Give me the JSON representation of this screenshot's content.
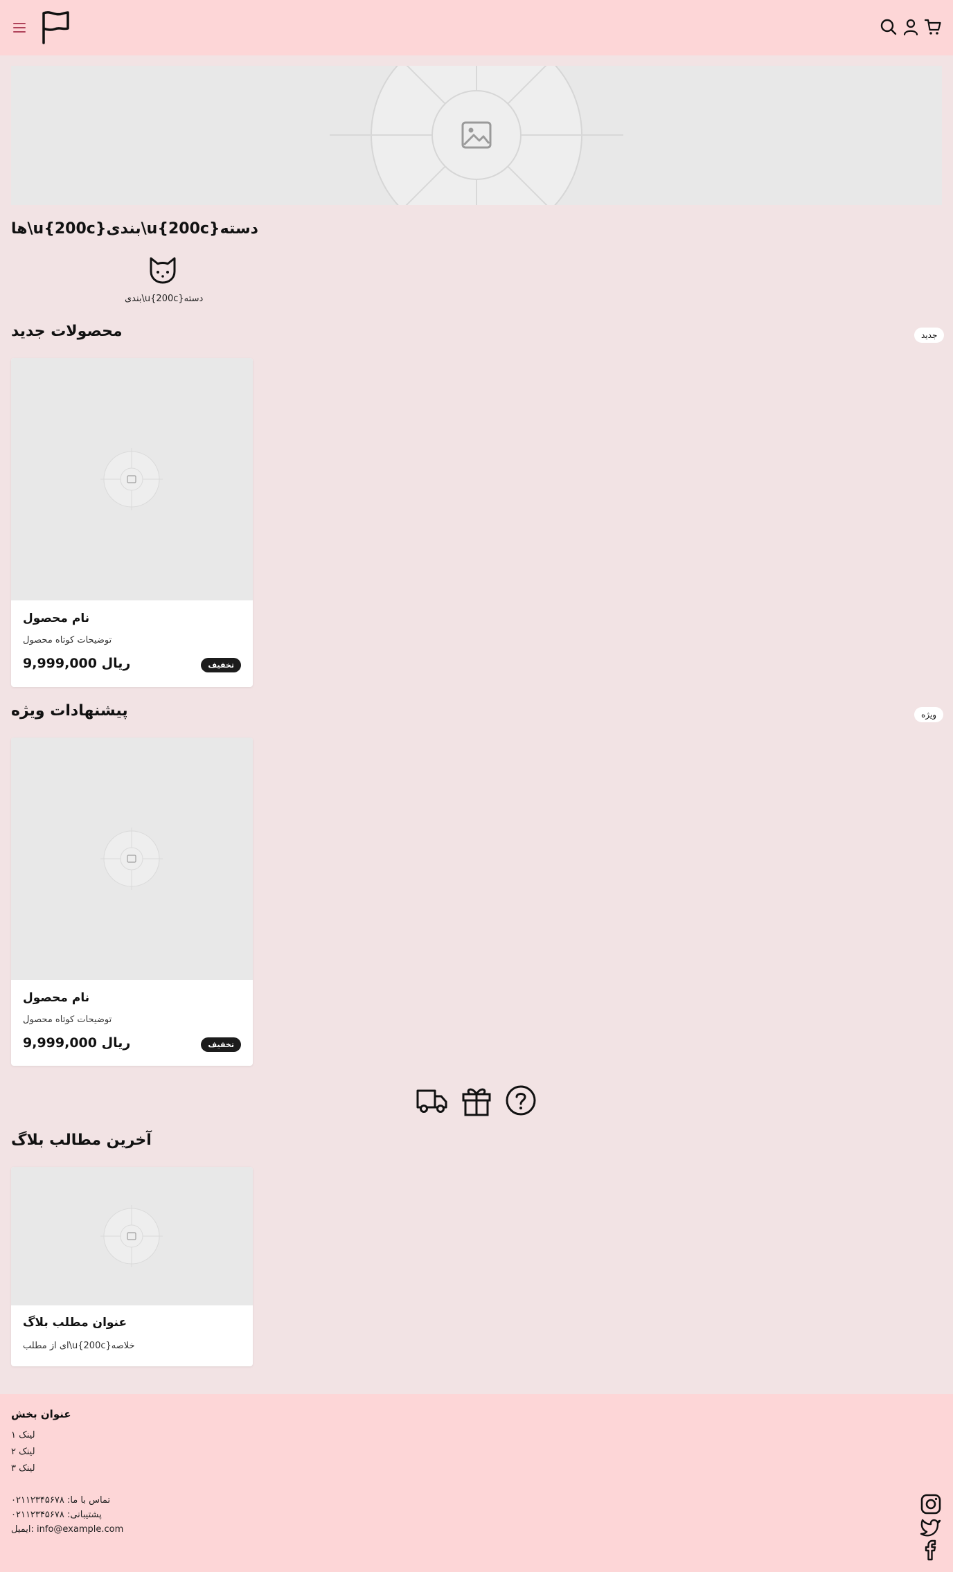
{
  "header": {
    "menu_icon": "hamburger-menu-icon",
    "logo_icon": "flag-logo",
    "search_icon": "search-icon",
    "account_icon": "user-icon",
    "cart_icon": "shopping-cart-icon"
  },
  "hero": {
    "image_icon": "image-placeholder-icon"
  },
  "categories": {
    "title": "ها\\u{200c}بندی\\u{200c}دسته",
    "items": [
      {
        "label": "بندی\\u{200c}دسته",
        "icon": "cat-face-icon"
      }
    ]
  },
  "new_products": {
    "title": "محصولات جدید",
    "pill": "جدید",
    "items": [
      {
        "name": "نام محصول",
        "description": "توضیحات کوتاه محصول",
        "price": "9,999,000 ریال",
        "badge": "تخفیف"
      }
    ]
  },
  "special_offers": {
    "title": "پیشنهادات ویژه",
    "pill": "ویژه",
    "items": [
      {
        "name": "نام محصول",
        "description": "توضیحات کوتاه محصول",
        "price": "9,999,000 ریال",
        "badge": "تخفیف"
      }
    ]
  },
  "features": {
    "icons": [
      "delivery-truck-icon",
      "gift-icon",
      "help-question-icon"
    ]
  },
  "blog": {
    "title": "آخرین مطالب بلاگ",
    "items": [
      {
        "title": "عنوان مطلب بلاگ",
        "excerpt": "ای از مطلب\\u{200c}خلاصه"
      }
    ]
  },
  "footer": {
    "section_title": "عنوان بخش",
    "links": [
      "لینک ۱",
      "لینک ۲",
      "لینک ۳"
    ],
    "contact_phone": "تماس با ما: ۰۲۱۱۲۳۴۵۶۷۸",
    "support_phone": "پشتیبانی: ۰۲۱۱۲۳۴۵۶۷۸",
    "email": "ایمیل: info@example.com",
    "social_icons": [
      "instagram-icon",
      "twitter-icon",
      "facebook-icon"
    ]
  },
  "colors": {
    "page_background": "#f2e3e4",
    "header_footer_background": "#fdd6d7",
    "placeholder_gray": "#e8e8e8",
    "badge_dark": "#1c1c1c",
    "menu_icon_accent": "#b0435a"
  }
}
